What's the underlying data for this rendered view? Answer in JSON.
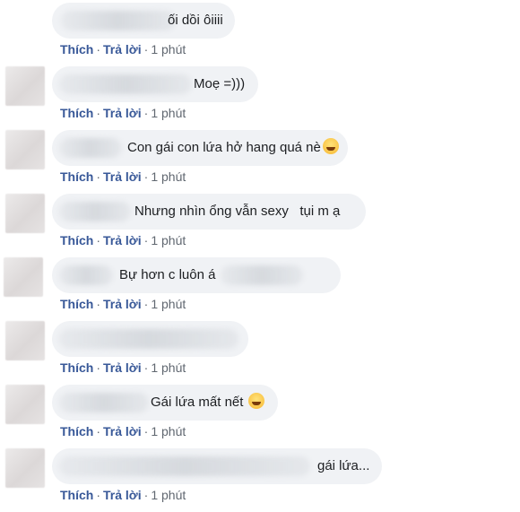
{
  "comments": [
    {
      "text": "ối dồi ôiiii",
      "has_avatar": false,
      "has_emoji": false,
      "actions": {
        "like": "Thích",
        "reply": "Trả lời",
        "time": "1 phút"
      }
    },
    {
      "text": "Moẹ =)))",
      "has_avatar": true,
      "has_emoji": false,
      "actions": {
        "like": "Thích",
        "reply": "Trả lời",
        "time": "1 phút"
      }
    },
    {
      "text": "Con gái con lứa hở hang quá nè",
      "has_avatar": true,
      "has_emoji": true,
      "emoji": "grinning-sweat-emoji",
      "actions": {
        "like": "Thích",
        "reply": "Trả lời",
        "time": "1 phút"
      }
    },
    {
      "text": "Nhưng nhìn ổng vẫn sexy   tụi m ạ",
      "has_avatar": true,
      "has_emoji": false,
      "actions": {
        "like": "Thích",
        "reply": "Trả lời",
        "time": "1 phút"
      }
    },
    {
      "text": "Bự hơn c luôn á",
      "has_avatar": true,
      "has_emoji": false,
      "actions": {
        "like": "Thích",
        "reply": "Trả lời",
        "time": "1 phút"
      }
    },
    {
      "text": "",
      "has_avatar": true,
      "has_emoji": false,
      "actions": {
        "like": "Thích",
        "reply": "Trả lời",
        "time": "1 phút"
      }
    },
    {
      "text": "Gái lứa mất nết",
      "has_avatar": true,
      "has_emoji": true,
      "emoji": "rolling-laughing-emoji",
      "actions": {
        "like": "Thích",
        "reply": "Trả lời",
        "time": "1 phút"
      }
    },
    {
      "text": "gái lứa...",
      "has_avatar": true,
      "has_emoji": false,
      "actions": {
        "like": "Thích",
        "reply": "Trả lời",
        "time": "1 phút"
      }
    }
  ],
  "colors": {
    "bubble": "#f0f2f5",
    "link": "#385898",
    "meta": "#606770",
    "text": "#1c1e21"
  }
}
